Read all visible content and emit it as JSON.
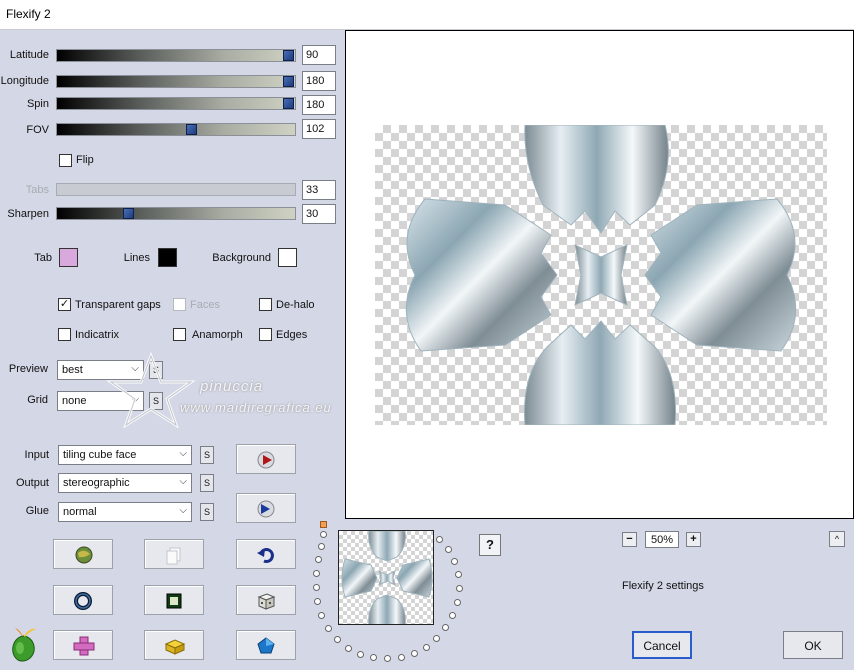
{
  "window": {
    "title": "Flexify 2"
  },
  "sliders": {
    "latitude": {
      "label": "Latitude",
      "value": "90",
      "fraction": 1.0
    },
    "longitude": {
      "label": "Longitude",
      "value": "180",
      "fraction": 1.0
    },
    "spin": {
      "label": "Spin",
      "value": "180",
      "fraction": 1.0
    },
    "fov": {
      "label": "FOV",
      "value": "102",
      "fraction": 0.55
    },
    "tabs": {
      "label": "Tabs",
      "value": "33",
      "fraction": 0.33,
      "disabled": true
    },
    "sharpen": {
      "label": "Sharpen",
      "value": "30",
      "fraction": 0.3
    }
  },
  "flip": {
    "label": "Flip",
    "checked": false
  },
  "colors": {
    "tab": {
      "label": "Tab",
      "color": "#d9a8dc"
    },
    "lines": {
      "label": "Lines",
      "color": "#000000"
    },
    "background": {
      "label": "Background",
      "color": "#ffffff"
    }
  },
  "options": {
    "transparent_gaps": {
      "label": "Transparent gaps",
      "checked": true
    },
    "faces": {
      "label": "Faces",
      "checked": false,
      "disabled": true
    },
    "de_halo": {
      "label": "De-halo",
      "checked": false
    },
    "indicatrix": {
      "label": "Indicatrix",
      "checked": false
    },
    "anamorph": {
      "label": "Anamorph",
      "checked": false
    },
    "edges": {
      "label": "Edges",
      "checked": false
    }
  },
  "selects": {
    "preview": {
      "label": "Preview",
      "value": "best"
    },
    "grid": {
      "label": "Grid",
      "value": "none"
    },
    "input": {
      "label": "Input",
      "value": "tiling cube face"
    },
    "output": {
      "label": "Output",
      "value": "stereographic"
    },
    "glue": {
      "label": "Glue",
      "value": "normal"
    }
  },
  "s_button_label": "S",
  "watermark": {
    "line1": "pinuccia",
    "line2": "www.maidiregrafica.eu"
  },
  "zoom": {
    "value": "50%",
    "minus": "−",
    "plus": "+"
  },
  "help_label": "?",
  "settings_label": "Flexify 2 settings",
  "buttons": {
    "cancel": "Cancel",
    "ok": "OK"
  },
  "collapse_label": "^",
  "colors_theme": {
    "dialog_bg": "#d4d8e6",
    "thumb": "#1d3c7c",
    "default_border": "#2a5dcc"
  }
}
